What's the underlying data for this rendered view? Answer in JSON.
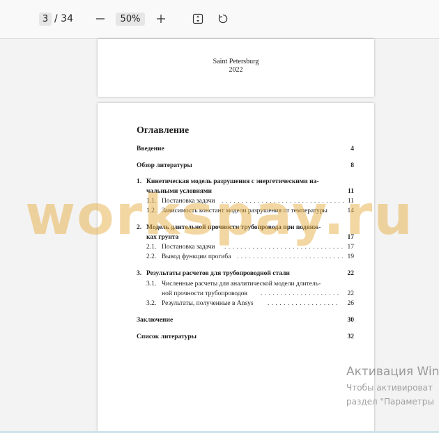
{
  "toolbar": {
    "current_page": "3",
    "page_total": "/ 34",
    "zoom": "50%",
    "icons": [
      "minus-icon",
      "plus-icon",
      "fit-page-icon",
      "rotate-icon"
    ]
  },
  "title_page": {
    "city": "Saint Petersburg",
    "year": "2022"
  },
  "toc": {
    "title": "Оглавление",
    "intro": {
      "text": "Введение",
      "page": "4"
    },
    "review": {
      "text": "Обзор литературы",
      "page": "8"
    },
    "ch1": {
      "num": "1.",
      "line1": "Кинетическая модель разрушения с энергетическими на-",
      "line2": "чальными условиями",
      "page": "11"
    },
    "s11": {
      "num": "1.1.",
      "text": "Постановка задачи",
      "page": "11"
    },
    "s12": {
      "num": "1.2.",
      "text": "Зависимость констант модели разрушения от температуры",
      "page": "14"
    },
    "ch2": {
      "num": "2.",
      "line1": "Модель длительной прочности трубопровода при подвиж-",
      "line2": "ках грунта",
      "page": "17"
    },
    "s21": {
      "num": "2.1.",
      "text": "Постановка задачи",
      "page": "17"
    },
    "s22": {
      "num": "2.2.",
      "text": "Вывод функции прогиба",
      "page": "19"
    },
    "ch3": {
      "num": "3.",
      "text": "Результаты расчетов для трубопроводной стали",
      "page": "22"
    },
    "s31": {
      "num": "3.1.",
      "line1": "Численные расчеты для аналитической модели длитель-",
      "line2": "ной прочности трубопроводов",
      "page": "22"
    },
    "s32": {
      "num": "3.2.",
      "text": "Результаты, полученные в Ansys",
      "page": "26"
    },
    "conclusion": {
      "text": "Заключение",
      "page": "30"
    },
    "refs": {
      "text": "Список литературы",
      "page": "32"
    }
  },
  "watermark": {
    "text": "workspay.ru"
  },
  "activation": {
    "title": "Активация Win",
    "line1": "Чтобы активироват",
    "line2": "раздел \"Параметры"
  }
}
